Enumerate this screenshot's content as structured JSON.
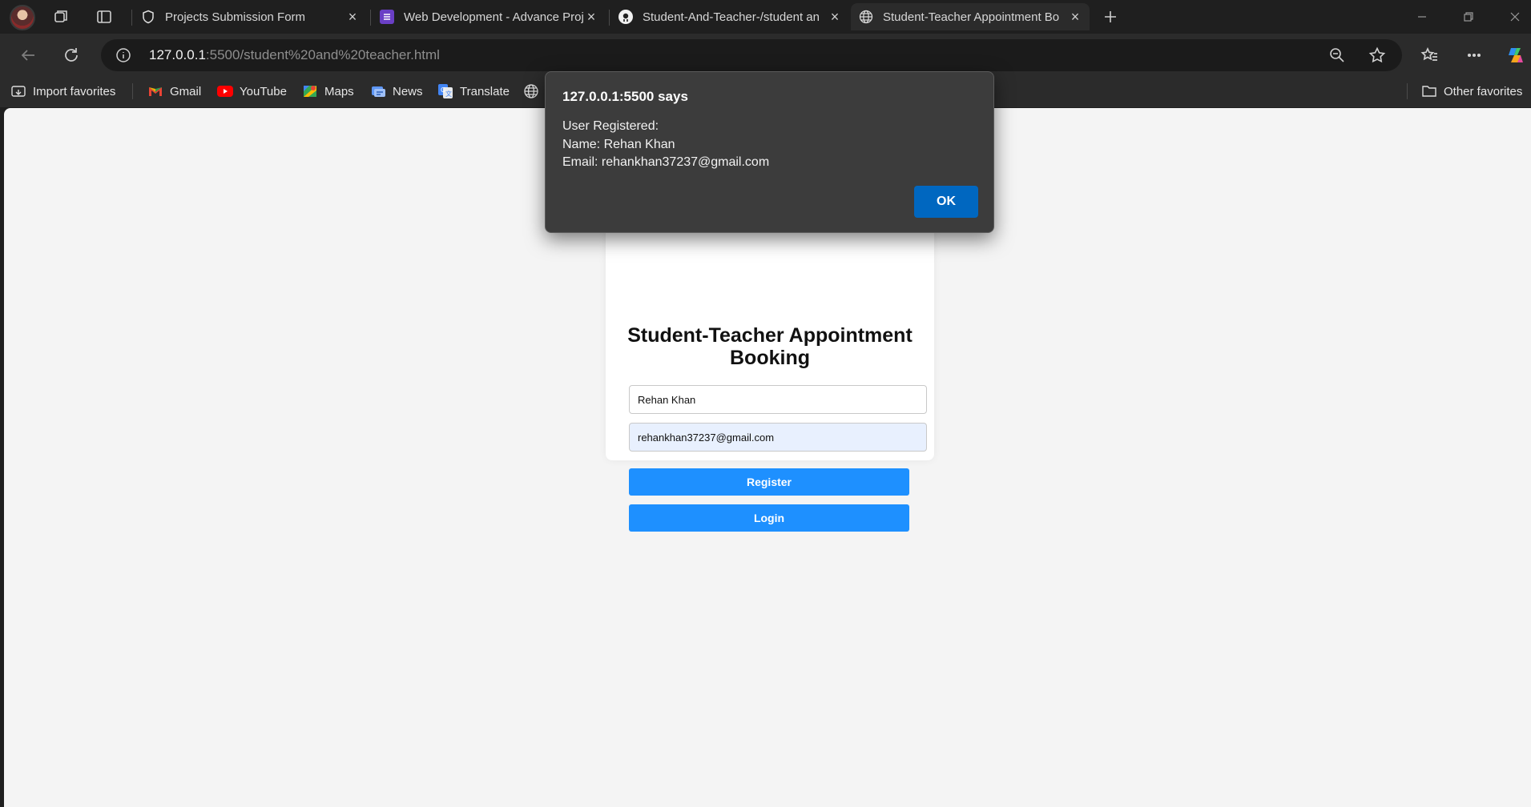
{
  "browser": {
    "tabs": [
      {
        "title": "Projects Submission Form",
        "active": false
      },
      {
        "title": "Web Development - Advance Proj",
        "active": false
      },
      {
        "title": "Student-And-Teacher-/student an",
        "active": false
      },
      {
        "title": "Student-Teacher Appointment Bo",
        "active": true
      }
    ],
    "address": {
      "host": "127.0.0.1",
      "rest": ":5500/student%20and%20teacher.html"
    },
    "favorites": [
      {
        "label": "Import favorites",
        "icon": "import-icon"
      },
      {
        "label": "Gmail",
        "icon": "gmail-icon"
      },
      {
        "label": "YouTube",
        "icon": "youtube-icon"
      },
      {
        "label": "Maps",
        "icon": "maps-icon"
      },
      {
        "label": "News",
        "icon": "news-icon"
      },
      {
        "label": "Translate",
        "icon": "translate-icon"
      }
    ],
    "other_favorites": "Other favorites"
  },
  "page": {
    "heading": "Student-Teacher Appointment Booking",
    "name_value": "Rehan Khan",
    "email_value": "rehankhan37237@gmail.com",
    "register_label": "Register",
    "login_label": "Login"
  },
  "dialog": {
    "title": "127.0.0.1:5500 says",
    "lines": [
      "User Registered:",
      "Name: Rehan Khan",
      "Email: rehankhan37237@gmail.com"
    ],
    "ok_label": "OK"
  },
  "colors": {
    "primary_button": "#1e90ff",
    "dialog_ok": "#0067c0",
    "page_bg": "#f4f4f4"
  }
}
